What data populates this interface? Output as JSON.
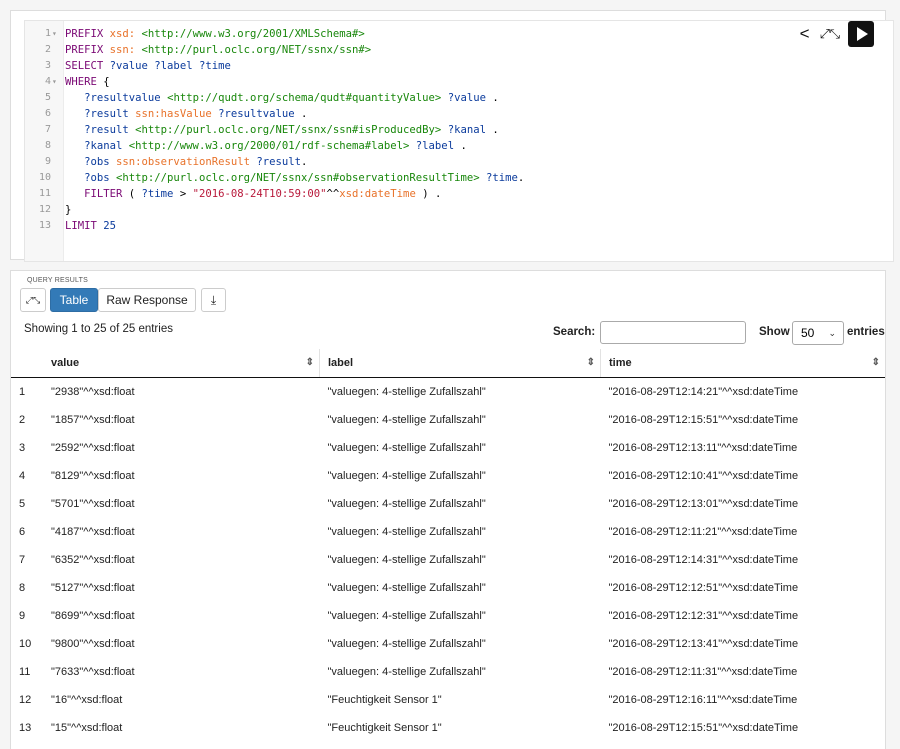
{
  "editor": {
    "lines": [
      {
        "n": "1",
        "fold": "▾",
        "segments": [
          {
            "t": "PREFIX ",
            "c": "kw"
          },
          {
            "t": "xsd:",
            "c": "pfx"
          },
          {
            "t": " <http://www.w3.org/2001/XMLSchema#>",
            "c": "uri"
          }
        ]
      },
      {
        "n": "2",
        "fold": "",
        "segments": [
          {
            "t": "PREFIX ",
            "c": "kw"
          },
          {
            "t": "ssn:",
            "c": "pfx"
          },
          {
            "t": " <http://purl.oclc.org/NET/ssnx/ssn#>",
            "c": "uri"
          }
        ]
      },
      {
        "n": "3",
        "fold": "",
        "segments": [
          {
            "t": "SELECT ",
            "c": "kw"
          },
          {
            "t": "?value ?label ?time",
            "c": "var"
          }
        ]
      },
      {
        "n": "4",
        "fold": "▾",
        "segments": [
          {
            "t": "WHERE ",
            "c": "kw"
          },
          {
            "t": "{",
            "c": "op"
          }
        ]
      },
      {
        "n": "5",
        "fold": "",
        "segments": [
          {
            "t": "   ?resultvalue ",
            "c": "var"
          },
          {
            "t": "<http://qudt.org/schema/qudt#quantityValue>",
            "c": "uri"
          },
          {
            "t": " ?value ",
            "c": "var"
          },
          {
            "t": ".",
            "c": "op"
          }
        ]
      },
      {
        "n": "6",
        "fold": "",
        "segments": [
          {
            "t": "   ?result ",
            "c": "var"
          },
          {
            "t": "ssn:hasValue",
            "c": "pfx"
          },
          {
            "t": " ?resultvalue ",
            "c": "var"
          },
          {
            "t": ".",
            "c": "op"
          }
        ]
      },
      {
        "n": "7",
        "fold": "",
        "segments": [
          {
            "t": "   ?result ",
            "c": "var"
          },
          {
            "t": "<http://purl.oclc.org/NET/ssnx/ssn#isProducedBy>",
            "c": "uri"
          },
          {
            "t": " ?kanal ",
            "c": "var"
          },
          {
            "t": ".",
            "c": "op"
          }
        ]
      },
      {
        "n": "8",
        "fold": "",
        "segments": [
          {
            "t": "   ?kanal ",
            "c": "var"
          },
          {
            "t": "<http://www.w3.org/2000/01/rdf-schema#label>",
            "c": "uri"
          },
          {
            "t": " ?label ",
            "c": "var"
          },
          {
            "t": ".",
            "c": "op"
          }
        ]
      },
      {
        "n": "9",
        "fold": "",
        "segments": [
          {
            "t": "   ?obs ",
            "c": "var"
          },
          {
            "t": "ssn:observationResult",
            "c": "pfx"
          },
          {
            "t": " ?result",
            "c": "var"
          },
          {
            "t": ".",
            "c": "op"
          }
        ]
      },
      {
        "n": "10",
        "fold": "",
        "segments": [
          {
            "t": "   ?obs ",
            "c": "var"
          },
          {
            "t": "<http://purl.oclc.org/NET/ssnx/ssn#observationResultTime>",
            "c": "uri"
          },
          {
            "t": " ?time",
            "c": "var"
          },
          {
            "t": ".",
            "c": "op"
          }
        ]
      },
      {
        "n": "11",
        "fold": "",
        "segments": [
          {
            "t": "   FILTER ",
            "c": "kw"
          },
          {
            "t": "( ",
            "c": "op"
          },
          {
            "t": "?time",
            "c": "var"
          },
          {
            "t": " > ",
            "c": "op"
          },
          {
            "t": "\"2016-08-24T10:59:00\"",
            "c": "str"
          },
          {
            "t": "^^",
            "c": "op"
          },
          {
            "t": "xsd:dateTime",
            "c": "pfx"
          },
          {
            "t": " ) .",
            "c": "op"
          }
        ]
      },
      {
        "n": "12",
        "fold": "",
        "segments": [
          {
            "t": "}",
            "c": "op"
          }
        ]
      },
      {
        "n": "13",
        "fold": "",
        "segments": [
          {
            "t": "LIMIT ",
            "c": "kw"
          },
          {
            "t": "25",
            "c": "var"
          }
        ]
      }
    ]
  },
  "results": {
    "title": "QUERY RESULTS",
    "table_button": "Table",
    "raw_button": "Raw Response",
    "showing": "Showing 1 to 25 of 25 entries",
    "search_label": "Search:",
    "show_label": "Show",
    "show_value": "50",
    "entries_label": "entries",
    "headers": [
      "value",
      "label",
      "time"
    ],
    "rows": [
      [
        "1",
        "\"2938\"^^xsd:float",
        "\"valuegen: 4-stellige Zufallszahl\"",
        "\"2016-08-29T12:14:21\"^^xsd:dateTime"
      ],
      [
        "2",
        "\"1857\"^^xsd:float",
        "\"valuegen: 4-stellige Zufallszahl\"",
        "\"2016-08-29T12:15:51\"^^xsd:dateTime"
      ],
      [
        "3",
        "\"2592\"^^xsd:float",
        "\"valuegen: 4-stellige Zufallszahl\"",
        "\"2016-08-29T12:13:11\"^^xsd:dateTime"
      ],
      [
        "4",
        "\"8129\"^^xsd:float",
        "\"valuegen: 4-stellige Zufallszahl\"",
        "\"2016-08-29T12:10:41\"^^xsd:dateTime"
      ],
      [
        "5",
        "\"5701\"^^xsd:float",
        "\"valuegen: 4-stellige Zufallszahl\"",
        "\"2016-08-29T12:13:01\"^^xsd:dateTime"
      ],
      [
        "6",
        "\"4187\"^^xsd:float",
        "\"valuegen: 4-stellige Zufallszahl\"",
        "\"2016-08-29T12:11:21\"^^xsd:dateTime"
      ],
      [
        "7",
        "\"6352\"^^xsd:float",
        "\"valuegen: 4-stellige Zufallszahl\"",
        "\"2016-08-29T12:14:31\"^^xsd:dateTime"
      ],
      [
        "8",
        "\"5127\"^^xsd:float",
        "\"valuegen: 4-stellige Zufallszahl\"",
        "\"2016-08-29T12:12:51\"^^xsd:dateTime"
      ],
      [
        "9",
        "\"8699\"^^xsd:float",
        "\"valuegen: 4-stellige Zufallszahl\"",
        "\"2016-08-29T12:12:31\"^^xsd:dateTime"
      ],
      [
        "10",
        "\"9800\"^^xsd:float",
        "\"valuegen: 4-stellige Zufallszahl\"",
        "\"2016-08-29T12:13:41\"^^xsd:dateTime"
      ],
      [
        "11",
        "\"7633\"^^xsd:float",
        "\"valuegen: 4-stellige Zufallszahl\"",
        "\"2016-08-29T12:11:31\"^^xsd:dateTime"
      ],
      [
        "12",
        "\"16\"^^xsd:float",
        "\"Feuchtigkeit Sensor 1\"",
        "\"2016-08-29T12:16:11\"^^xsd:dateTime"
      ],
      [
        "13",
        "\"15\"^^xsd:float",
        "\"Feuchtigkeit Sensor 1\"",
        "\"2016-08-29T12:15:51\"^^xsd:dateTime"
      ]
    ]
  },
  "icons": {
    "share": "share-icon",
    "expand": "fullscreen-icon",
    "run": "play-icon",
    "download": "download-icon",
    "sort": "sort-icon"
  }
}
